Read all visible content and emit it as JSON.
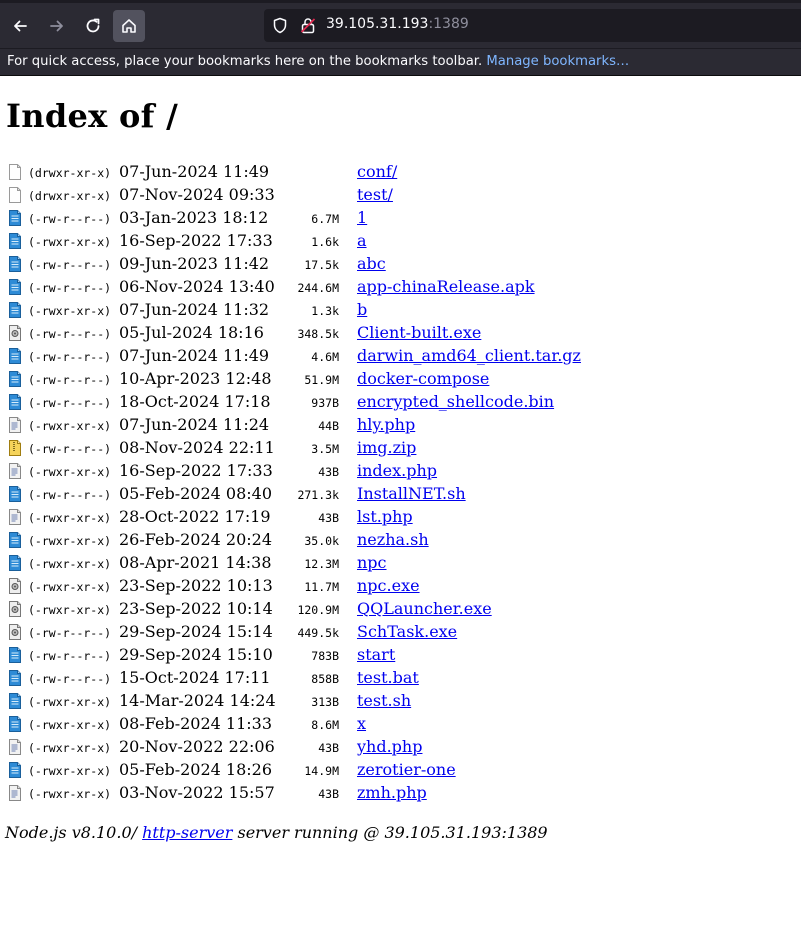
{
  "browser": {
    "url_host": "39.105.31.193",
    "url_port": ":1389",
    "bookmarks_message": "For quick access, place your bookmarks here on the bookmarks toolbar.",
    "bookmarks_link": "Manage bookmarks…"
  },
  "page": {
    "title": "Index of /",
    "entries": [
      {
        "perms": "(drwxr-xr-x)",
        "date": "07-Jun-2024 11:49",
        "size": "",
        "name": "conf/",
        "icon": "folder-icon"
      },
      {
        "perms": "(drwxr-xr-x)",
        "date": "07-Nov-2024 09:33",
        "size": "",
        "name": "test/",
        "icon": "folder-icon"
      },
      {
        "perms": "(-rw-r--r--)",
        "date": "03-Jan-2023 18:12",
        "size": "6.7M",
        "name": "1",
        "icon": "file-icon"
      },
      {
        "perms": "(-rwxr-xr-x)",
        "date": "16-Sep-2022 17:33",
        "size": "1.6k",
        "name": "a",
        "icon": "file-icon"
      },
      {
        "perms": "(-rw-r--r--)",
        "date": "09-Jun-2023 11:42",
        "size": "17.5k",
        "name": "abc",
        "icon": "file-icon"
      },
      {
        "perms": "(-rw-r--r--)",
        "date": "06-Nov-2024 13:40",
        "size": "244.6M",
        "name": "app-chinaRelease.apk",
        "icon": "file-icon"
      },
      {
        "perms": "(-rwxr-xr-x)",
        "date": "07-Jun-2024 11:32",
        "size": "1.3k",
        "name": "b",
        "icon": "file-icon"
      },
      {
        "perms": "(-rw-r--r--)",
        "date": "05-Jul-2024 18:16",
        "size": "348.5k",
        "name": "Client-built.exe",
        "icon": "exe-icon"
      },
      {
        "perms": "(-rw-r--r--)",
        "date": "07-Jun-2024 11:49",
        "size": "4.6M",
        "name": "darwin_amd64_client.tar.gz",
        "icon": "file-icon"
      },
      {
        "perms": "(-rw-r--r--)",
        "date": "10-Apr-2023 12:48",
        "size": "51.9M",
        "name": "docker-compose",
        "icon": "file-icon"
      },
      {
        "perms": "(-rw-r--r--)",
        "date": "18-Oct-2024 17:18",
        "size": "937B",
        "name": "encrypted_shellcode.bin",
        "icon": "file-icon"
      },
      {
        "perms": "(-rwxr-xr-x)",
        "date": "07-Jun-2024 11:24",
        "size": "44B",
        "name": "hly.php",
        "icon": "php-icon"
      },
      {
        "perms": "(-rw-r--r--)",
        "date": "08-Nov-2024 22:11",
        "size": "3.5M",
        "name": "img.zip",
        "icon": "zip-icon"
      },
      {
        "perms": "(-rwxr-xr-x)",
        "date": "16-Sep-2022 17:33",
        "size": "43B",
        "name": "index.php",
        "icon": "php-icon"
      },
      {
        "perms": "(-rw-r--r--)",
        "date": "05-Feb-2024 08:40",
        "size": "271.3k",
        "name": "InstallNET.sh",
        "icon": "file-icon"
      },
      {
        "perms": "(-rwxr-xr-x)",
        "date": "28-Oct-2022 17:19",
        "size": "43B",
        "name": "lst.php",
        "icon": "php-icon"
      },
      {
        "perms": "(-rwxr-xr-x)",
        "date": "26-Feb-2024 20:24",
        "size": "35.0k",
        "name": "nezha.sh",
        "icon": "file-icon"
      },
      {
        "perms": "(-rwxr-xr-x)",
        "date": "08-Apr-2021 14:38",
        "size": "12.3M",
        "name": "npc",
        "icon": "file-icon"
      },
      {
        "perms": "(-rwxr-xr-x)",
        "date": "23-Sep-2022 10:13",
        "size": "11.7M",
        "name": "npc.exe",
        "icon": "exe-icon"
      },
      {
        "perms": "(-rwxr-xr-x)",
        "date": "23-Sep-2022 10:14",
        "size": "120.9M",
        "name": "QQLauncher.exe",
        "icon": "exe-icon"
      },
      {
        "perms": "(-rw-r--r--)",
        "date": "29-Sep-2024 15:14",
        "size": "449.5k",
        "name": "SchTask.exe",
        "icon": "exe-icon"
      },
      {
        "perms": "(-rw-r--r--)",
        "date": "29-Sep-2024 15:10",
        "size": "783B",
        "name": "start",
        "icon": "file-icon"
      },
      {
        "perms": "(-rw-r--r--)",
        "date": "15-Oct-2024 17:11",
        "size": "858B",
        "name": "test.bat",
        "icon": "file-icon"
      },
      {
        "perms": "(-rwxr-xr-x)",
        "date": "14-Mar-2024 14:24",
        "size": "313B",
        "name": "test.sh",
        "icon": "file-icon"
      },
      {
        "perms": "(-rwxr-xr-x)",
        "date": "08-Feb-2024 11:33",
        "size": "8.6M",
        "name": "x",
        "icon": "file-icon"
      },
      {
        "perms": "(-rwxr-xr-x)",
        "date": "20-Nov-2022 22:06",
        "size": "43B",
        "name": "yhd.php",
        "icon": "php-icon"
      },
      {
        "perms": "(-rwxr-xr-x)",
        "date": "05-Feb-2024 18:26",
        "size": "14.9M",
        "name": "zerotier-one",
        "icon": "file-icon"
      },
      {
        "perms": "(-rwxr-xr-x)",
        "date": "03-Nov-2022 15:57",
        "size": "43B",
        "name": "zmh.php",
        "icon": "php-icon"
      }
    ],
    "footer": {
      "prefix": "Node.js v8.10.0/ ",
      "link": "http-server",
      "suffix": " server running @ 39.105.31.193:1389"
    }
  },
  "colors": {
    "chrome_bg": "#2b2a33",
    "urlbar_bg": "#1c1b22",
    "link": "#0000ee",
    "bookmark_link": "#7fb6ff"
  }
}
